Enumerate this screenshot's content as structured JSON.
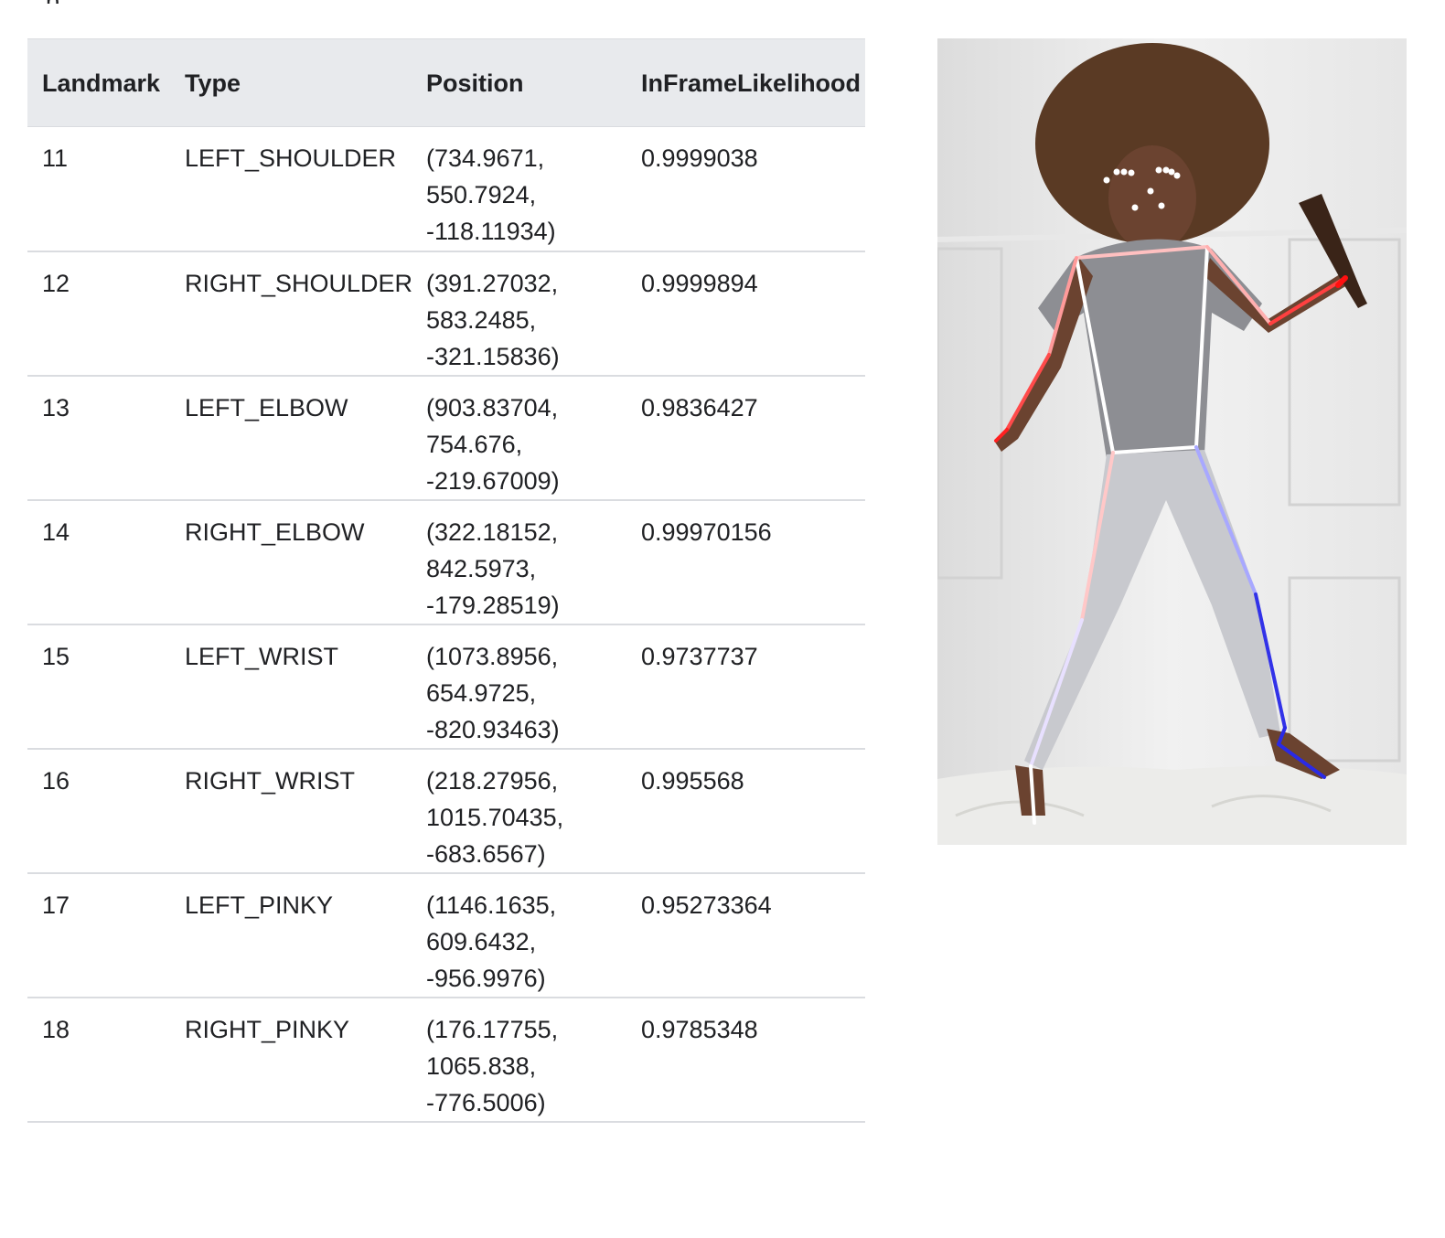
{
  "table": {
    "headers": [
      "Landmark",
      "Type",
      "Position",
      "InFrameLikelihood"
    ],
    "rows": [
      {
        "landmark": "11",
        "type": "LEFT_SHOULDER",
        "position": [
          "(734.9671,",
          "550.7924,",
          "-118.11934)"
        ],
        "likelihood": "0.9999038"
      },
      {
        "landmark": "12",
        "type": "RIGHT_SHOULDER",
        "position": [
          "(391.27032,",
          "583.2485,",
          "-321.15836)"
        ],
        "likelihood": "0.9999894"
      },
      {
        "landmark": "13",
        "type": "LEFT_ELBOW",
        "position": [
          "(903.83704,",
          "754.676,",
          "-219.67009)"
        ],
        "likelihood": "0.9836427"
      },
      {
        "landmark": "14",
        "type": "RIGHT_ELBOW",
        "position": [
          "(322.18152,",
          "842.5973,",
          "-179.28519)"
        ],
        "likelihood": "0.99970156"
      },
      {
        "landmark": "15",
        "type": "LEFT_WRIST",
        "position": [
          "(1073.8956,",
          "654.9725,",
          "-820.93463)"
        ],
        "likelihood": "0.9737737"
      },
      {
        "landmark": "16",
        "type": "RIGHT_WRIST",
        "position": [
          "(218.27956,",
          "1015.70435,",
          "-683.6567)"
        ],
        "likelihood": "0.995568"
      },
      {
        "landmark": "17",
        "type": "LEFT_PINKY",
        "position": [
          "(1146.1635,",
          "609.6432,",
          "-956.9976)"
        ],
        "likelihood": "0.95273364"
      },
      {
        "landmark": "18",
        "type": "RIGHT_PINKY",
        "position": [
          "(176.17755,",
          "1065.838,",
          "-776.5006)"
        ],
        "likelihood": "0.9785348"
      }
    ]
  },
  "colors": {
    "header_bg": "#e8eaed",
    "row_border": "#dadce0",
    "text": "#202124",
    "skeleton_right_side": "#ff6b6b",
    "skeleton_left_side": "#4a4af0",
    "skeleton_torso": "#ffffff"
  }
}
